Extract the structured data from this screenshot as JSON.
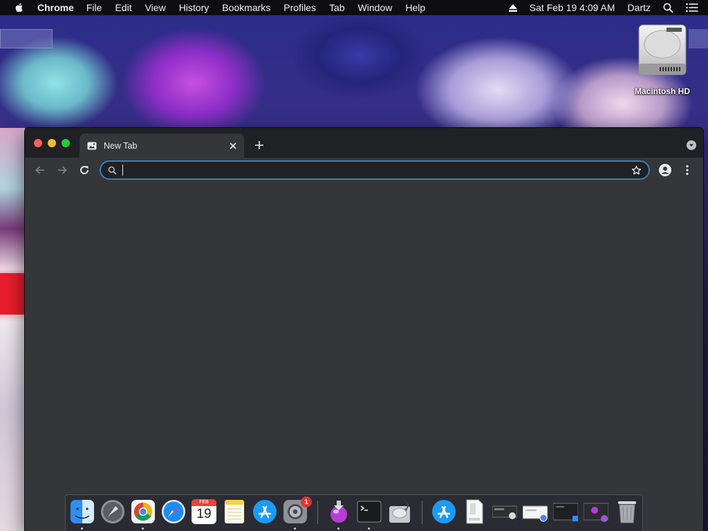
{
  "menubar": {
    "app_name": "Chrome",
    "items": [
      "File",
      "Edit",
      "View",
      "History",
      "Bookmarks",
      "Profiles",
      "Tab",
      "Window",
      "Help"
    ],
    "datetime": "Sat Feb 19  4:09 AM",
    "user": "Dartz"
  },
  "desktop": {
    "disk_label": "Macintosh HD"
  },
  "browser": {
    "tab_title": "New Tab",
    "omnibox_value": ""
  },
  "dock": {
    "calendar_month": "FEB",
    "calendar_day": "19",
    "settings_badge": "1"
  },
  "colors": {
    "window_bg": "#35363a",
    "titlebar_bg": "#202124",
    "omnibox_focus": "#3c7fb5",
    "badge": "#e3342f"
  }
}
